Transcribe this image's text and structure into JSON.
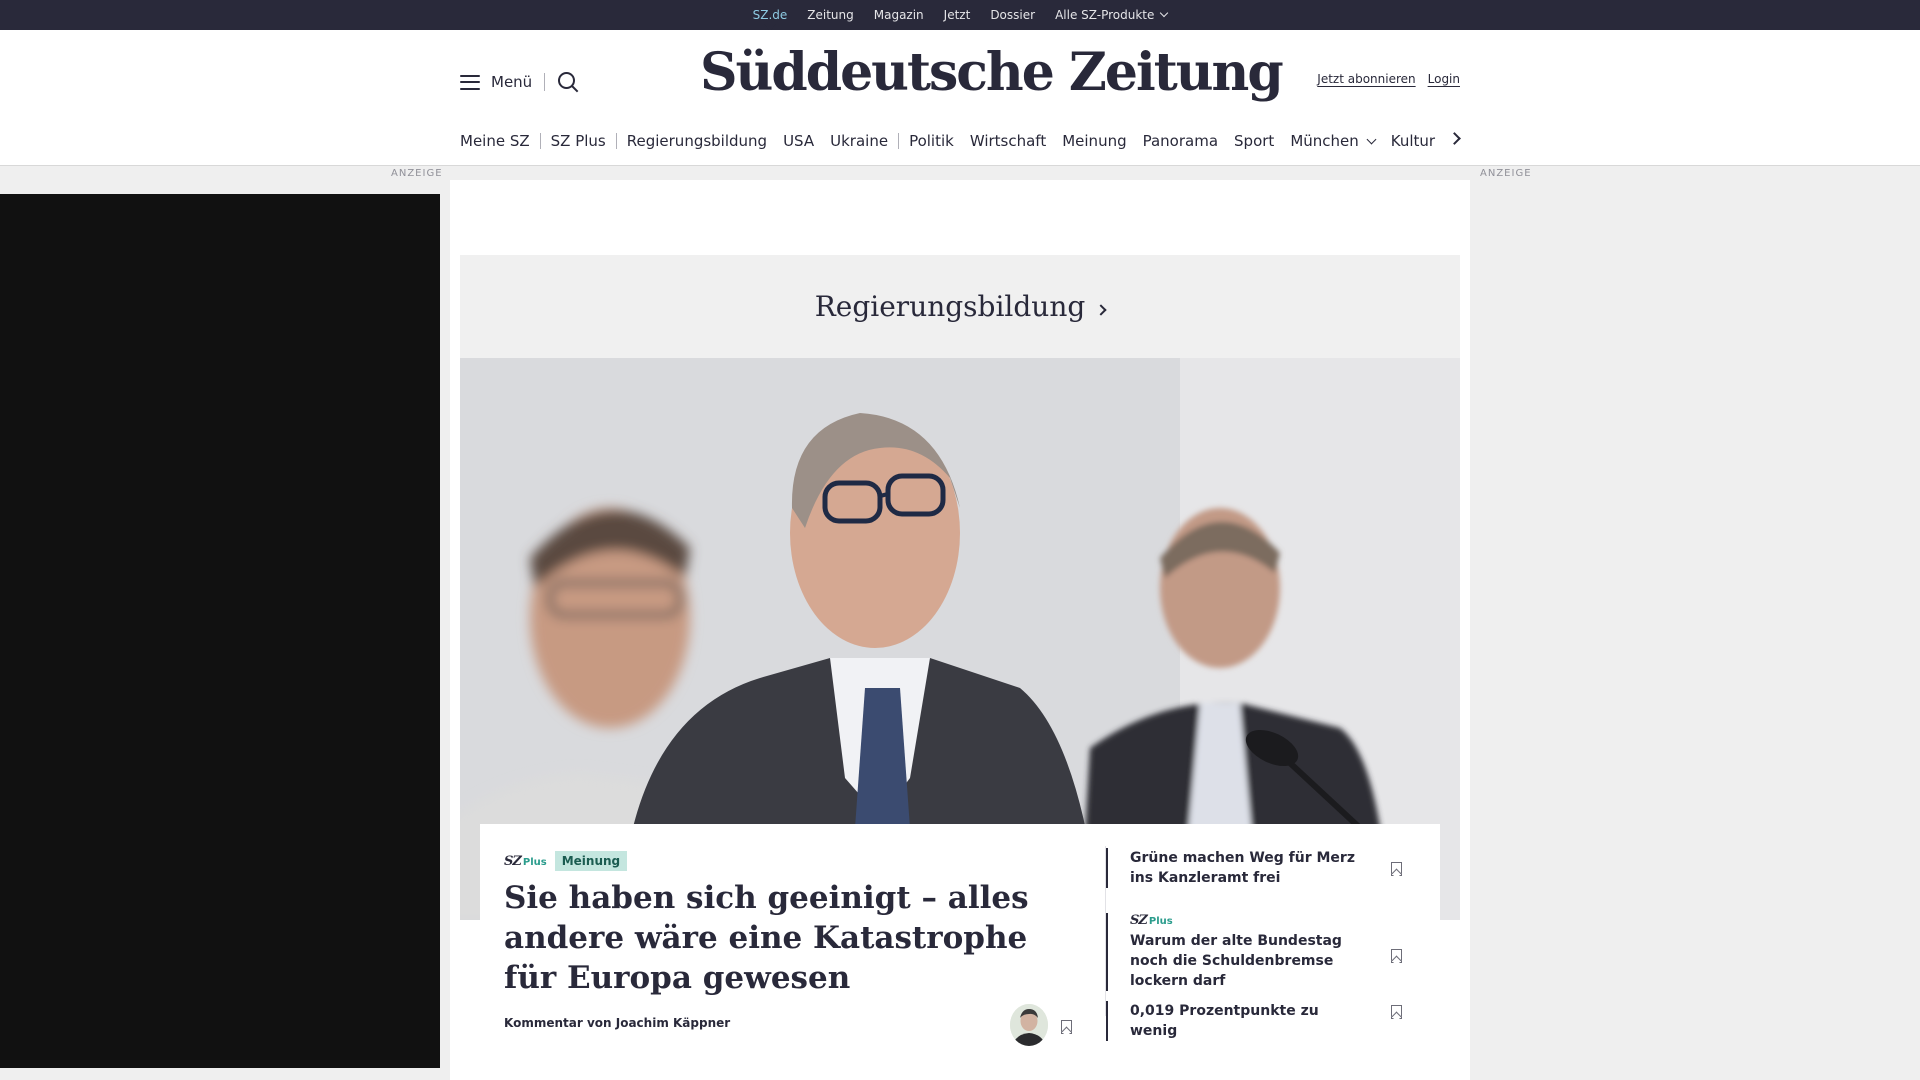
{
  "topbar": {
    "items": [
      "SZ.de",
      "Zeitung",
      "Magazin",
      "Jetzt",
      "Dossier",
      "Alle SZ-Produkte"
    ]
  },
  "header": {
    "menu_label": "Menü",
    "logo_text": "Süddeutsche Zeitung",
    "subscribe_label": "Jetzt abonnieren",
    "login_label": "Login"
  },
  "nav": {
    "items": [
      "Meine SZ",
      "SZ Plus",
      "Regierungsbildung",
      "USA",
      "Ukraine",
      "Politik",
      "Wirtschaft",
      "Meinung",
      "Panorama",
      "Sport",
      "München",
      "Kultur"
    ]
  },
  "ads": {
    "left_label": "ANZEIGE",
    "right_label": "ANZEIGE"
  },
  "hero": {
    "kicker": "Regierungsbildung"
  },
  "article": {
    "plus_logo": "SZ",
    "plus_suffix": "Plus",
    "tag": "Meinung",
    "headline": "Sie haben sich geeinigt – alles andere wäre eine Katastrophe für Europa gewesen",
    "byline": "Kommentar von Joachim Käppner"
  },
  "related": [
    {
      "title": "Grüne machen Weg für Merz ins Kanzleramt frei",
      "plus": false
    },
    {
      "title": "Warum der alte Bundestag noch die Schuldenbremse lockern darf",
      "plus": true,
      "plus_logo": "SZ",
      "plus_suffix": "Plus"
    },
    {
      "title": "0,019 Prozentpunkte zu wenig",
      "plus": false
    }
  ],
  "colors": {
    "brand_dark": "#29293a",
    "topbar_active": "#8ecbe3",
    "plus_green": "#2a9c8c",
    "badge_bg": "#c4e6df"
  }
}
